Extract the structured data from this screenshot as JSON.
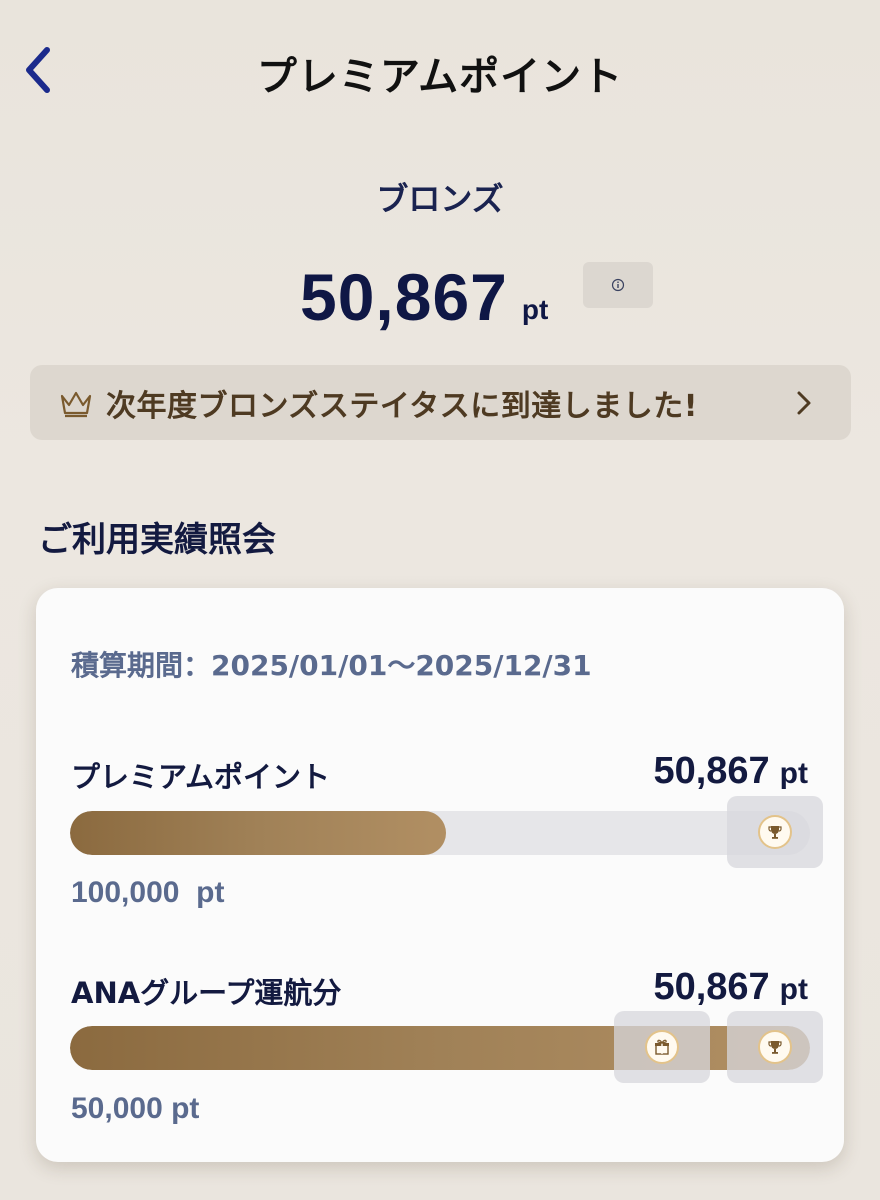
{
  "header": {
    "title": "プレミアムポイント",
    "back_icon": "chevron-left-icon"
  },
  "summary": {
    "tier_name": "ブロンズ",
    "points_value": "50,867",
    "points_unit": "pt",
    "info_icon": "info-icon"
  },
  "status_banner": {
    "text": "次年度ブロンズステイタスに到達しました!",
    "icon": "crown-icon",
    "chevron_icon": "chevron-right-icon"
  },
  "usage_section": {
    "title": "ご利用実績照会",
    "period": "積算期間：2025/01/01～2025/12/31",
    "metrics": [
      {
        "label": "プレミアムポイント",
        "value": "50,867",
        "unit": "pt",
        "target": "100,000  pt",
        "progress": 0.508,
        "markers": [
          "trophy-icon"
        ]
      },
      {
        "label": "ANAグループ運航分",
        "value": "50,867",
        "unit": "pt",
        "target": "50,000 pt",
        "progress": 1.0,
        "markers": [
          "gift-icon",
          "trophy-icon"
        ]
      }
    ]
  },
  "colors": {
    "navy": "#131a40",
    "bronze_start": "#8b6a3f",
    "bronze_end": "#b18f63",
    "muted_blue": "#5a6a8e",
    "banner_text": "#4e3a22"
  }
}
